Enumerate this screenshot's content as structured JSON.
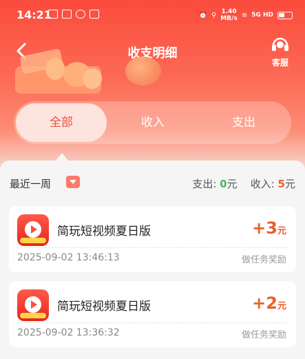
{
  "status_bar": {
    "time": "14:21",
    "net_speed_value": "1.40",
    "net_speed_unit": "MB/s",
    "signal": "5G HD"
  },
  "header": {
    "title": "收支明细",
    "service_label": "客服"
  },
  "tabs": [
    {
      "label": "全部",
      "active": true
    },
    {
      "label": "收入",
      "active": false
    },
    {
      "label": "支出",
      "active": false
    }
  ],
  "filter": {
    "label": "最近一周"
  },
  "summary": {
    "expense_label": "支出:",
    "expense_value": "0",
    "expense_unit": "元",
    "income_label": "收入:",
    "income_value": "5",
    "income_unit": "元"
  },
  "records": [
    {
      "app": "简玩短视频夏日版",
      "amount": "+3",
      "unit": "元",
      "time": "2025-09-02 13:46:13",
      "note": "做任务奖励"
    },
    {
      "app": "简玩短视频夏日版",
      "amount": "+2",
      "unit": "元",
      "time": "2025-09-02 13:36:32",
      "note": "做任务奖励"
    }
  ],
  "colors": {
    "primary": "#f24c3c",
    "income": "#e9602c",
    "expense": "#4bb66a"
  }
}
